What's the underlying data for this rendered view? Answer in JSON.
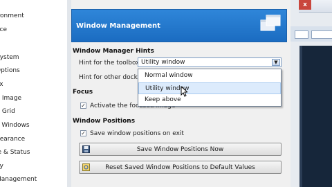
{
  "sidebar": {
    "items": [
      {
        "label": "ironment"
      },
      {
        "label": "ace"
      },
      {
        "label": "e"
      },
      {
        "label": "System"
      },
      {
        "label": "Options"
      },
      {
        "label": "ox"
      },
      {
        "label": "lt Image"
      },
      {
        "label": "lt Grid"
      },
      {
        "label": "e Windows"
      },
      {
        "label": "pearance"
      },
      {
        "label": "le & Status"
      },
      {
        "label": "ay"
      },
      {
        "label": "Management"
      }
    ]
  },
  "banner": {
    "title": "Window Management",
    "icon": "windows-icon"
  },
  "hints": {
    "section": "Window Manager Hints",
    "toolbox_label": "Hint for the toolbox:",
    "toolbox_value": "Utility window",
    "docks_label": "Hint for other docks:",
    "options": [
      "Normal window",
      "Utility window",
      "Keep above"
    ]
  },
  "focus": {
    "section": "Focus",
    "activate_label": "Activate the focused image",
    "activate_checked": true
  },
  "positions": {
    "section": "Window Positions",
    "save_on_exit_label": "Save window positions on exit",
    "save_on_exit_checked": true,
    "save_now_button": "Save Window Positions Now",
    "reset_button": "Reset Saved Window Positions to Default Values"
  },
  "check_glyph": "✓",
  "close_glyph": "x",
  "colors": {
    "banner": "#1f74c8",
    "hover": "#dcebfc",
    "dark_bg": "#16263a"
  }
}
